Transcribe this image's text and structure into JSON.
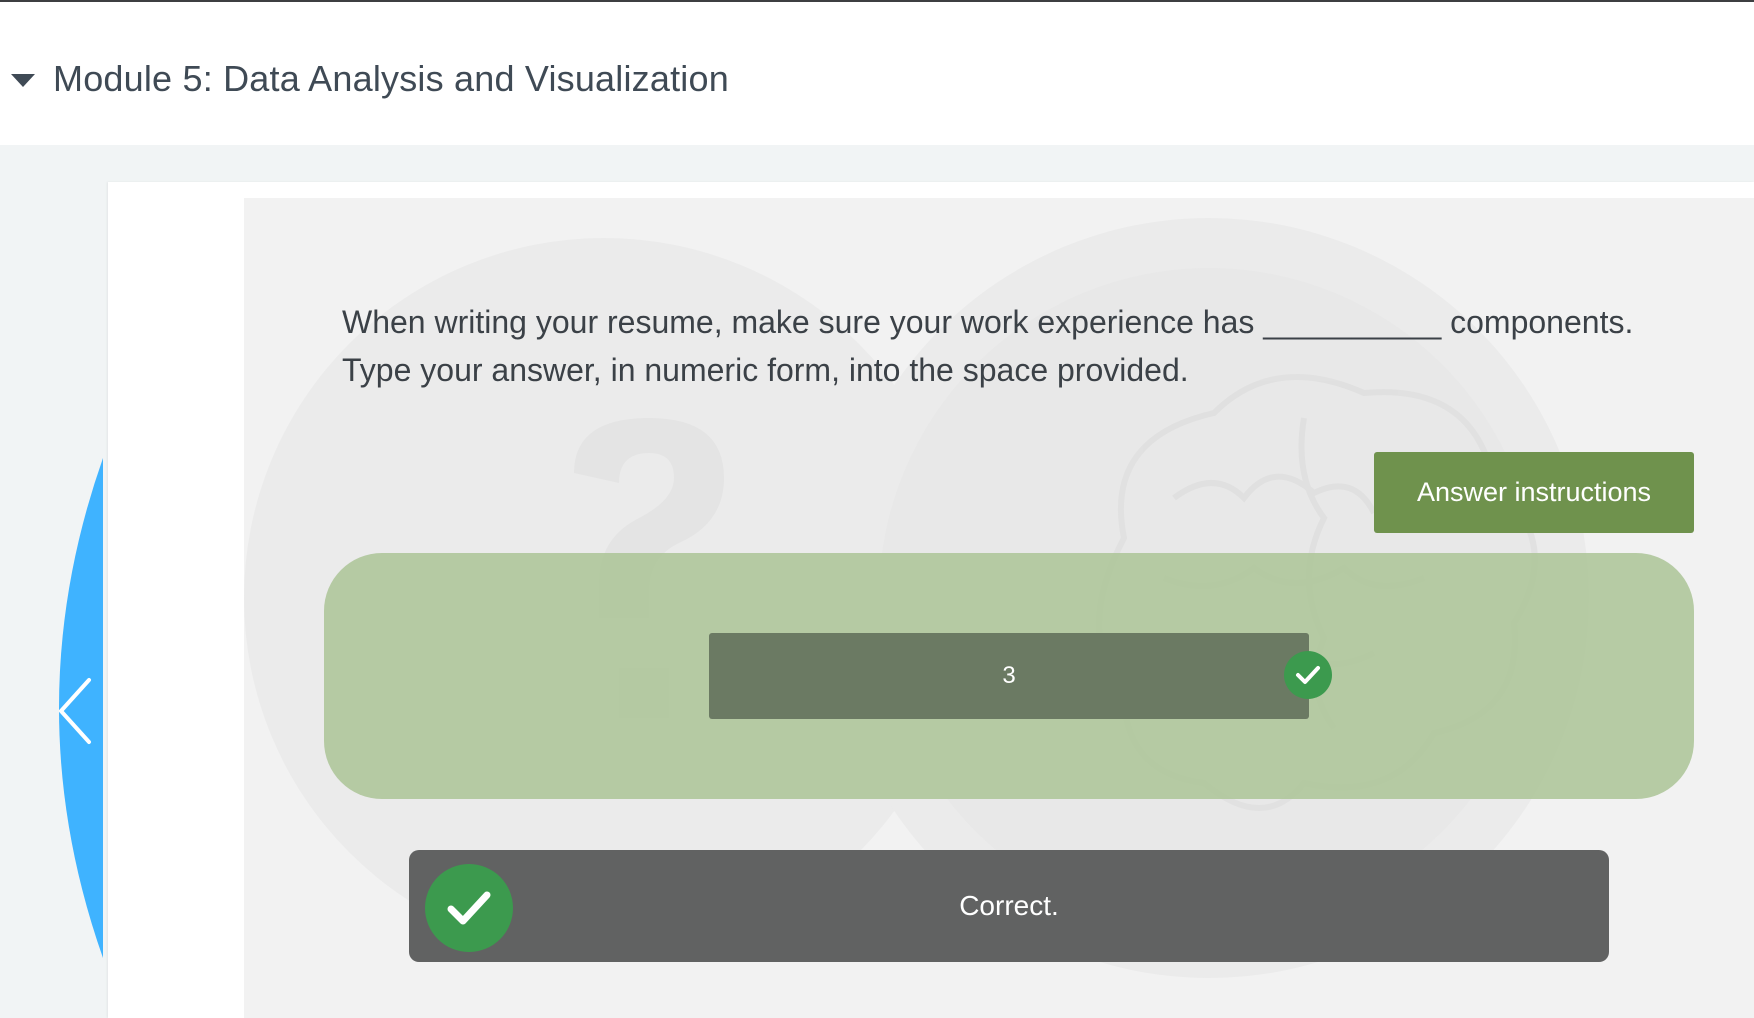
{
  "header": {
    "module_title": "Module 5: Data Analysis and Visualization",
    "toggle_icon": "caret-down-icon"
  },
  "question": {
    "line1": "When writing your resume, make sure your work experience has __________ components.",
    "line2": "Type your answer, in numeric form, into the space provided."
  },
  "answer_instructions_label": "Answer instructions",
  "answer": {
    "value": "3",
    "status_icon": "check-circle-icon"
  },
  "feedback": {
    "message": "Correct.",
    "icon": "check-circle-icon"
  },
  "nav": {
    "prev_icon": "chevron-left-icon"
  },
  "colors": {
    "accent_green": "#6f924d",
    "success_green": "#3c9a4e",
    "nav_blue": "#3fb3ff",
    "panel_green": "#acc496",
    "feedback_gray": "#616262"
  }
}
